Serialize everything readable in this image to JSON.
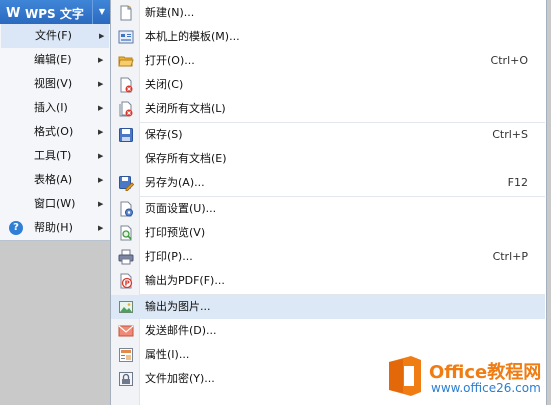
{
  "app": {
    "title": "WPS 文字",
    "logo_letter": "W"
  },
  "menubar": {
    "items": [
      {
        "label": "文件(F)",
        "active": true
      },
      {
        "label": "编辑(E)"
      },
      {
        "label": "视图(V)"
      },
      {
        "label": "插入(I)"
      },
      {
        "label": "格式(O)"
      },
      {
        "label": "工具(T)"
      },
      {
        "label": "表格(A)"
      },
      {
        "label": "窗口(W)"
      },
      {
        "label": "帮助(H)",
        "icon": "help-icon",
        "icon_glyph": "?"
      }
    ],
    "arrow": "▶"
  },
  "file_menu": {
    "items": [
      {
        "label": "新建(N)...",
        "shortcut": "",
        "icon": "new-document-icon"
      },
      {
        "label": "本机上的模板(M)...",
        "shortcut": "",
        "icon": "template-icon"
      },
      {
        "label": "打开(O)...",
        "shortcut": "Ctrl+O",
        "icon": "open-folder-icon"
      },
      {
        "label": "关闭(C)",
        "shortcut": "",
        "icon": "close-document-icon"
      },
      {
        "label": "关闭所有文档(L)",
        "shortcut": "",
        "icon": "close-all-icon"
      },
      {
        "label": "保存(S)",
        "shortcut": "Ctrl+S",
        "icon": "save-icon"
      },
      {
        "label": "保存所有文档(E)",
        "shortcut": "",
        "icon": ""
      },
      {
        "label": "另存为(A)...",
        "shortcut": "F12",
        "icon": "save-as-icon"
      },
      {
        "label": "页面设置(U)...",
        "shortcut": "",
        "icon": "page-setup-icon"
      },
      {
        "label": "打印预览(V)",
        "shortcut": "",
        "icon": "print-preview-icon"
      },
      {
        "label": "打印(P)...",
        "shortcut": "Ctrl+P",
        "icon": "printer-icon"
      },
      {
        "label": "输出为PDF(F)...",
        "shortcut": "",
        "icon": "pdf-icon"
      },
      {
        "label": "输出为图片...",
        "shortcut": "",
        "icon": "image-export-icon",
        "highlighted": true
      },
      {
        "label": "发送邮件(D)...",
        "shortcut": "",
        "icon": "mail-icon"
      },
      {
        "label": "属性(I)...",
        "shortcut": "",
        "icon": "properties-icon"
      },
      {
        "label": "文件加密(Y)...",
        "shortcut": "",
        "icon": "encrypt-icon"
      }
    ]
  },
  "watermark": {
    "line1": "Office教程网",
    "line2": "www.office26.com"
  },
  "colors": {
    "accent": "#2a69bf",
    "highlight": "#dde8f6",
    "watermark_orange": "#ef7d14",
    "watermark_blue": "#2c7fd0"
  }
}
